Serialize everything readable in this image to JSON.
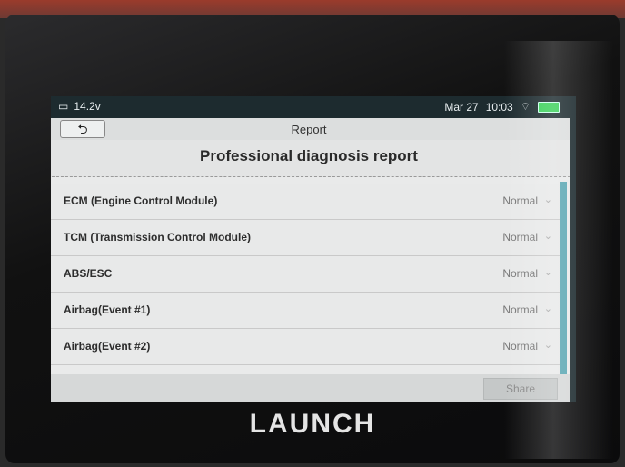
{
  "status_bar": {
    "voltage": "14.2v",
    "date": "Mar 27",
    "time": "10:03"
  },
  "window": {
    "title": "Report",
    "back_icon": "back-arrow-icon"
  },
  "report": {
    "heading": "Professional diagnosis report",
    "modules": [
      {
        "name": "ECM (Engine Control Module)",
        "status": "Normal"
      },
      {
        "name": "TCM (Transmission Control Module)",
        "status": "Normal"
      },
      {
        "name": "ABS/ESC",
        "status": "Normal"
      },
      {
        "name": "Airbag(Event #1)",
        "status": "Normal"
      },
      {
        "name": "Airbag(Event #2)",
        "status": "Normal"
      }
    ]
  },
  "footer": {
    "share_label": "Share"
  },
  "device": {
    "brand": "LAUNCH"
  },
  "colors": {
    "accent": "#5aa7b3",
    "battery": "#3bd15a"
  }
}
